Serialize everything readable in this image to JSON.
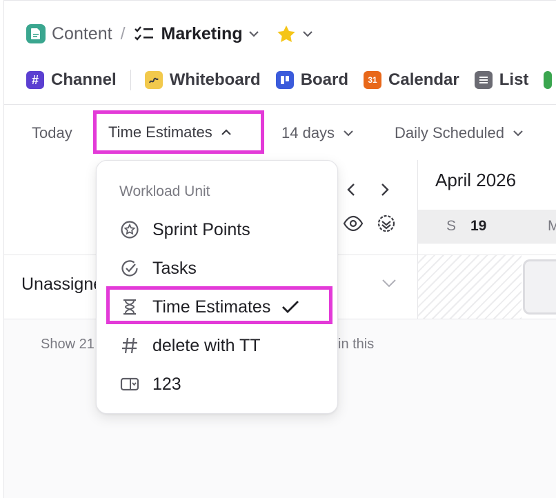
{
  "breadcrumb": {
    "space": "Content",
    "separator": "/",
    "list": "Marketing"
  },
  "view_tabs": [
    {
      "label": "Channel",
      "icon": "hash-icon",
      "color": "#5b3fd1"
    },
    {
      "label": "Whiteboard",
      "icon": "whiteboard-icon",
      "color": "#f2c94c"
    },
    {
      "label": "Board",
      "icon": "board-icon",
      "color": "#3b5bdb"
    },
    {
      "label": "Calendar",
      "icon": "calendar-icon",
      "color": "#e8681a",
      "badge": "31"
    },
    {
      "label": "List",
      "icon": "list-icon",
      "color": "#6b6b73"
    }
  ],
  "toolbar": {
    "today": "Today",
    "unit": "Time Estimates",
    "range": "14 days",
    "mode": "Daily Scheduled"
  },
  "calendar": {
    "month": "April 2026",
    "day_letter": "S",
    "day_number": "19",
    "next_day_letter": "M"
  },
  "row": {
    "label": "Unassigned"
  },
  "footer_text": {
    "left": "Show 21",
    "right": "in this"
  },
  "dropdown": {
    "title": "Workload Unit",
    "items": [
      {
        "label": "Sprint Points",
        "icon": "sprint-points-icon",
        "selected": false
      },
      {
        "label": "Tasks",
        "icon": "check-circle-icon",
        "selected": false
      },
      {
        "label": "Time Estimates",
        "icon": "hourglass-icon",
        "selected": true
      },
      {
        "label": "delete with TT",
        "icon": "hash-icon",
        "selected": false
      },
      {
        "label": "123",
        "icon": "field-icon",
        "selected": false
      }
    ]
  },
  "colors": {
    "highlight": "#e33ad8",
    "space_icon": "#3aa68f",
    "star": "#f5c518"
  }
}
